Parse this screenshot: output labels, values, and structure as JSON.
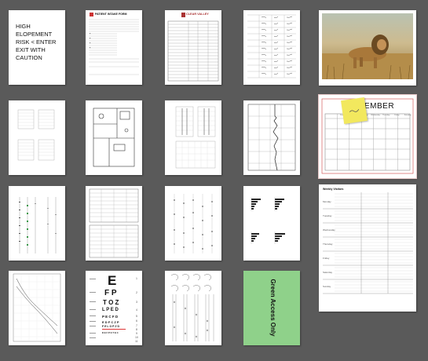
{
  "thumbnails": [
    {
      "id": 1,
      "kind": "text-sign",
      "lines": [
        "HIGH",
        "ELOPEMENT",
        "RISK < ENTER",
        "EXIT WITH",
        "CAUTION"
      ]
    },
    {
      "id": 2,
      "kind": "form",
      "title": "PATIENT INTAKE FORM"
    },
    {
      "id": 3,
      "kind": "form-table",
      "title": "CLEAR VALLEY"
    },
    {
      "id": 4,
      "kind": "handwritten-table"
    },
    {
      "id": 5,
      "kind": "photo",
      "subject": "lion"
    },
    {
      "id": 6,
      "kind": "dense-table"
    },
    {
      "id": 7,
      "kind": "floor-plan"
    },
    {
      "id": 8,
      "kind": "grid-charts"
    },
    {
      "id": 9,
      "kind": "ecg-chart"
    },
    {
      "id": 10,
      "kind": "calendar",
      "month_fragment": "EMBER",
      "days": [
        "Sunday",
        "Monday",
        "Tuesday",
        "Wednesday",
        "Thursday",
        "Friday",
        "Saturday"
      ]
    },
    {
      "id": 11,
      "kind": "column-chart"
    },
    {
      "id": 12,
      "kind": "data-form"
    },
    {
      "id": 13,
      "kind": "dot-grid"
    },
    {
      "id": 14,
      "kind": "bar-charts"
    },
    {
      "id": 15,
      "kind": "visitor-log",
      "title": "Weekly Visitors",
      "days": [
        "Monday",
        "Tuesday",
        "Wednesday",
        "Thursday",
        "Friday",
        "Saturday",
        "Sunday"
      ]
    },
    {
      "id": 16,
      "kind": "growth-chart"
    },
    {
      "id": 17,
      "kind": "eye-chart",
      "rows": [
        "E",
        "F P",
        "T O Z",
        "L P E D",
        "P E C F D",
        "E D F C Z P",
        "F E L O P Z D",
        "D E F P O T E C"
      ],
      "row_numbers": [
        "1",
        "2",
        "3",
        "4",
        "5",
        "6",
        "7",
        "8",
        "9",
        "10",
        "11"
      ]
    },
    {
      "id": 18,
      "kind": "sign-language-chart"
    },
    {
      "id": 19,
      "kind": "color-sign",
      "text": "Green Access Only",
      "color": "#8fd18a"
    }
  ],
  "colors": {
    "canvas": "#5a5a5a",
    "page": "#ffffff",
    "sticky": "#f2e85e",
    "accent_red": "#d33"
  }
}
